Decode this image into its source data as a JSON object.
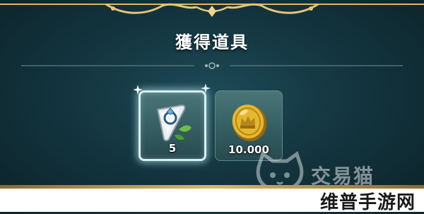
{
  "dialog": {
    "title": "獲得道具"
  },
  "rewards": [
    {
      "icon": "gem-ticket-icon",
      "count": "5",
      "selected": true
    },
    {
      "icon": "crown-coin-icon",
      "count": "10.000",
      "selected": false
    }
  ],
  "watermark": {
    "site_name": "交易猫",
    "site_name_2": "维普手游网"
  },
  "colors": {
    "frame_gold": "#d8b86a",
    "slot_teal": "#3d6a6d",
    "coin_gold": "#e6b82e",
    "background": "#143640"
  }
}
